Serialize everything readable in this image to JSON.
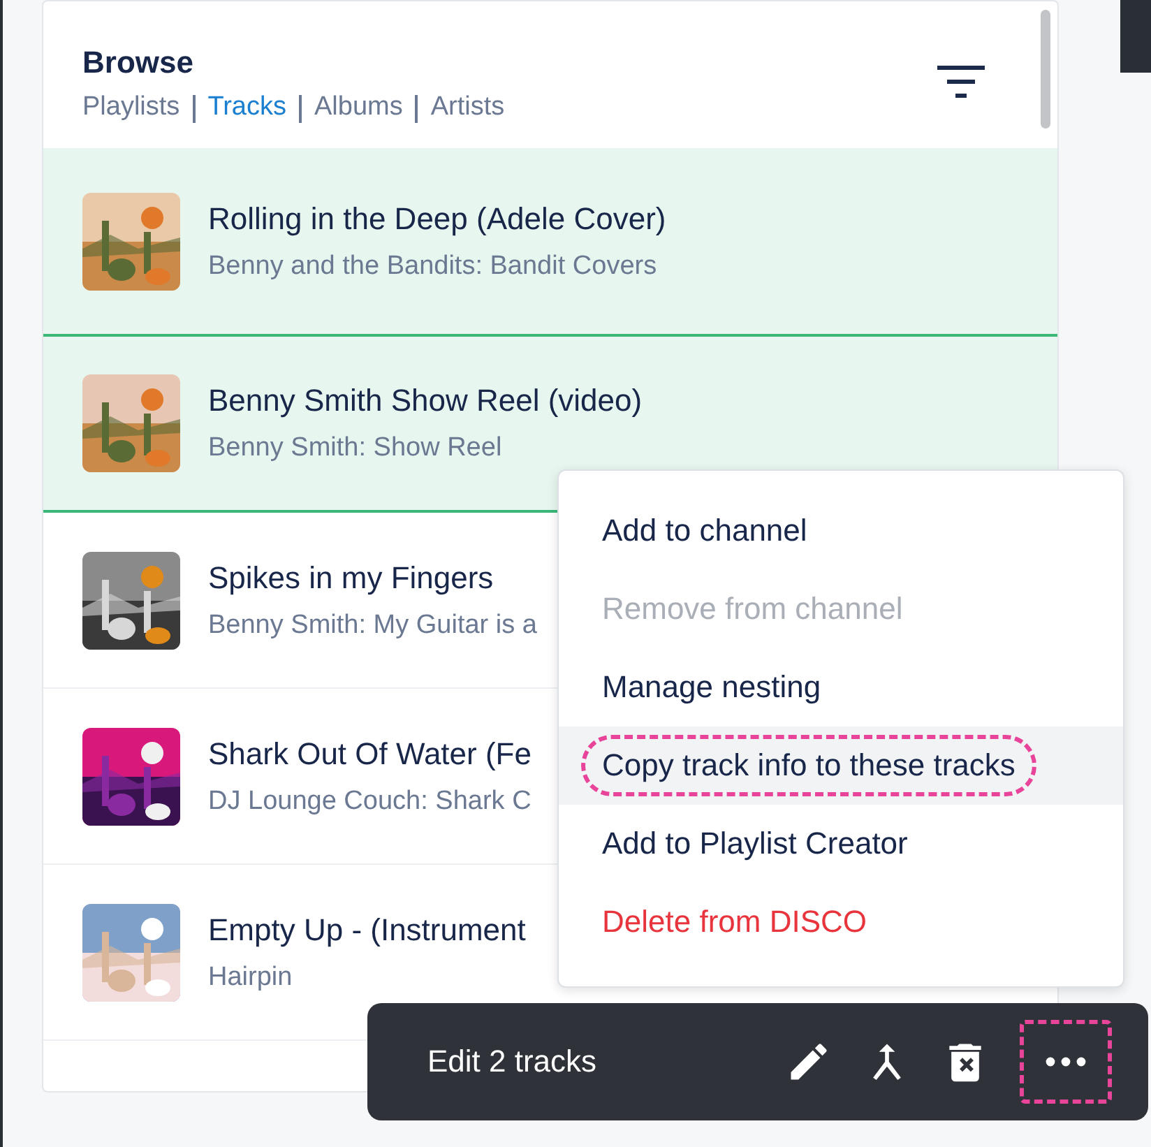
{
  "browse": {
    "title": "Browse",
    "tabs": [
      {
        "label": "Playlists",
        "selected": false
      },
      {
        "label": "Tracks",
        "selected": true
      },
      {
        "label": "Albums",
        "selected": false
      },
      {
        "label": "Artists",
        "selected": false
      }
    ]
  },
  "tracks": [
    {
      "title": "Rolling in the Deep (Adele Cover)",
      "subtitle": "Benny and the Bandits: Bandit Covers",
      "selected": true
    },
    {
      "title": "Benny Smith Show Reel (video)",
      "subtitle": "Benny Smith: Show Reel",
      "selected": true
    },
    {
      "title": "Spikes in my Fingers",
      "subtitle": "Benny Smith: My Guitar is a",
      "selected": false
    },
    {
      "title": "Shark Out Of Water (Fe",
      "subtitle": "DJ Lounge Couch: Shark C",
      "selected": false
    },
    {
      "title": "Empty Up - (Instrument",
      "subtitle": "Hairpin",
      "selected": false
    }
  ],
  "context_menu": [
    {
      "label": "Add to channel",
      "kind": "normal",
      "disabled": false,
      "highlighted": false,
      "annotated": false
    },
    {
      "label": "Remove from channel",
      "kind": "normal",
      "disabled": true,
      "highlighted": false,
      "annotated": false
    },
    {
      "label": "Manage nesting",
      "kind": "normal",
      "disabled": false,
      "highlighted": false,
      "annotated": false
    },
    {
      "label": "Copy track info to these tracks",
      "kind": "normal",
      "disabled": false,
      "highlighted": true,
      "annotated": true
    },
    {
      "label": "Add to Playlist Creator",
      "kind": "normal",
      "disabled": false,
      "highlighted": false,
      "annotated": false
    },
    {
      "label": "Delete from DISCO",
      "kind": "danger",
      "disabled": false,
      "highlighted": false,
      "annotated": false
    }
  ],
  "action_bar": {
    "label": "Edit 2 tracks",
    "more_annotated": true
  }
}
